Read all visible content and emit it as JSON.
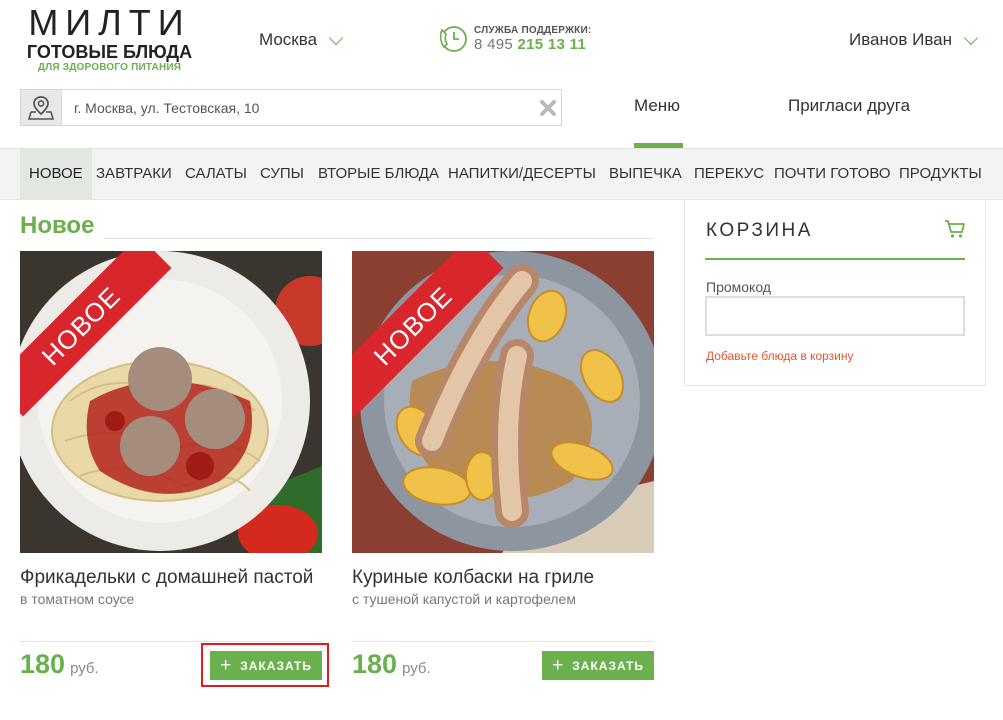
{
  "logo": {
    "main": "МИЛТИ",
    "sub": "ГОТОВЫЕ БЛЮДА",
    "tagline": "ДЛЯ ЗДОРОВОГО ПИТАНИЯ"
  },
  "header": {
    "city": "Москва",
    "support_label": "СЛУЖБА ПОДДЕРЖКИ:",
    "support_phone_prefix": "8 495",
    "support_phone_main": "215 13 11",
    "user_name": "Иванов Иван"
  },
  "address": {
    "value": "г. Москва, ул. Тестовская, 10"
  },
  "topnav": {
    "menu": "Меню",
    "invite": "Пригласи друга"
  },
  "categories": [
    "НОВОЕ",
    "ЗАВТРАКИ",
    "САЛАТЫ",
    "СУПЫ",
    "ВТОРЫЕ БЛЮДА",
    "НАПИТКИ/ДЕСЕРТЫ",
    "ВЫПЕЧКА",
    "ПЕРЕКУС",
    "ПОЧТИ ГОТОВО",
    "ПРОДУКТЫ"
  ],
  "section": {
    "title": "Новое"
  },
  "products": [
    {
      "badge": "НОВОЕ",
      "title": "Фрикадельки с домашней пастой",
      "subtitle": "в томатном соусе",
      "price": "180",
      "currency": "руб.",
      "order_label": "ЗАКАЗАТЬ"
    },
    {
      "badge": "НОВОЕ",
      "title": "Куриные колбаски на гриле",
      "subtitle": "с тушеной капустой и картофелем",
      "price": "180",
      "currency": "руб.",
      "order_label": "ЗАКАЗАТЬ"
    }
  ],
  "cart": {
    "title": "КОРЗИНА",
    "promo_label": "Промокод",
    "empty_message": "Добавьте блюда в корзину"
  },
  "colors": {
    "accent": "#6ab04c",
    "badge": "#d9262c",
    "warning": "#e4572e"
  }
}
